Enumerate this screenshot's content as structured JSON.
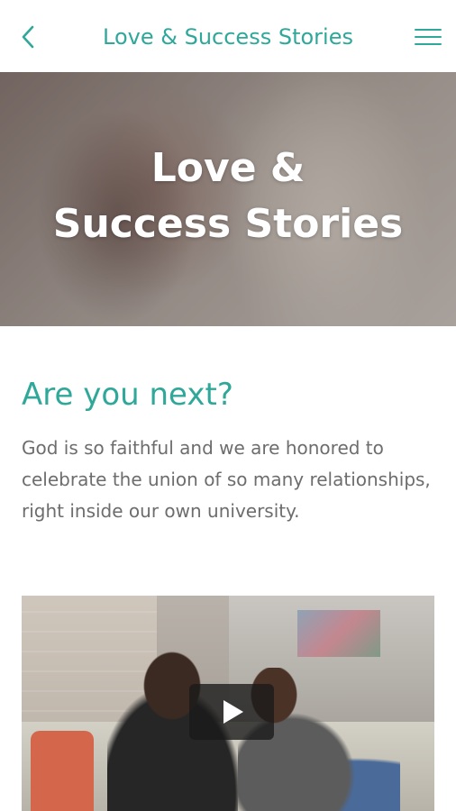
{
  "header": {
    "title": "Love & Success Stories",
    "back_icon": "chevron-left-icon",
    "menu_icon": "hamburger-menu-icon",
    "accent_color": "#2fa89a"
  },
  "hero": {
    "title_line1": "Love &",
    "title_line2": "Success Stories"
  },
  "section": {
    "heading": "Are you next?",
    "body": "God is so faithful and we are honored to celebrate the union of so many relationships, right inside our own university."
  },
  "video": {
    "play_icon": "play-icon"
  }
}
